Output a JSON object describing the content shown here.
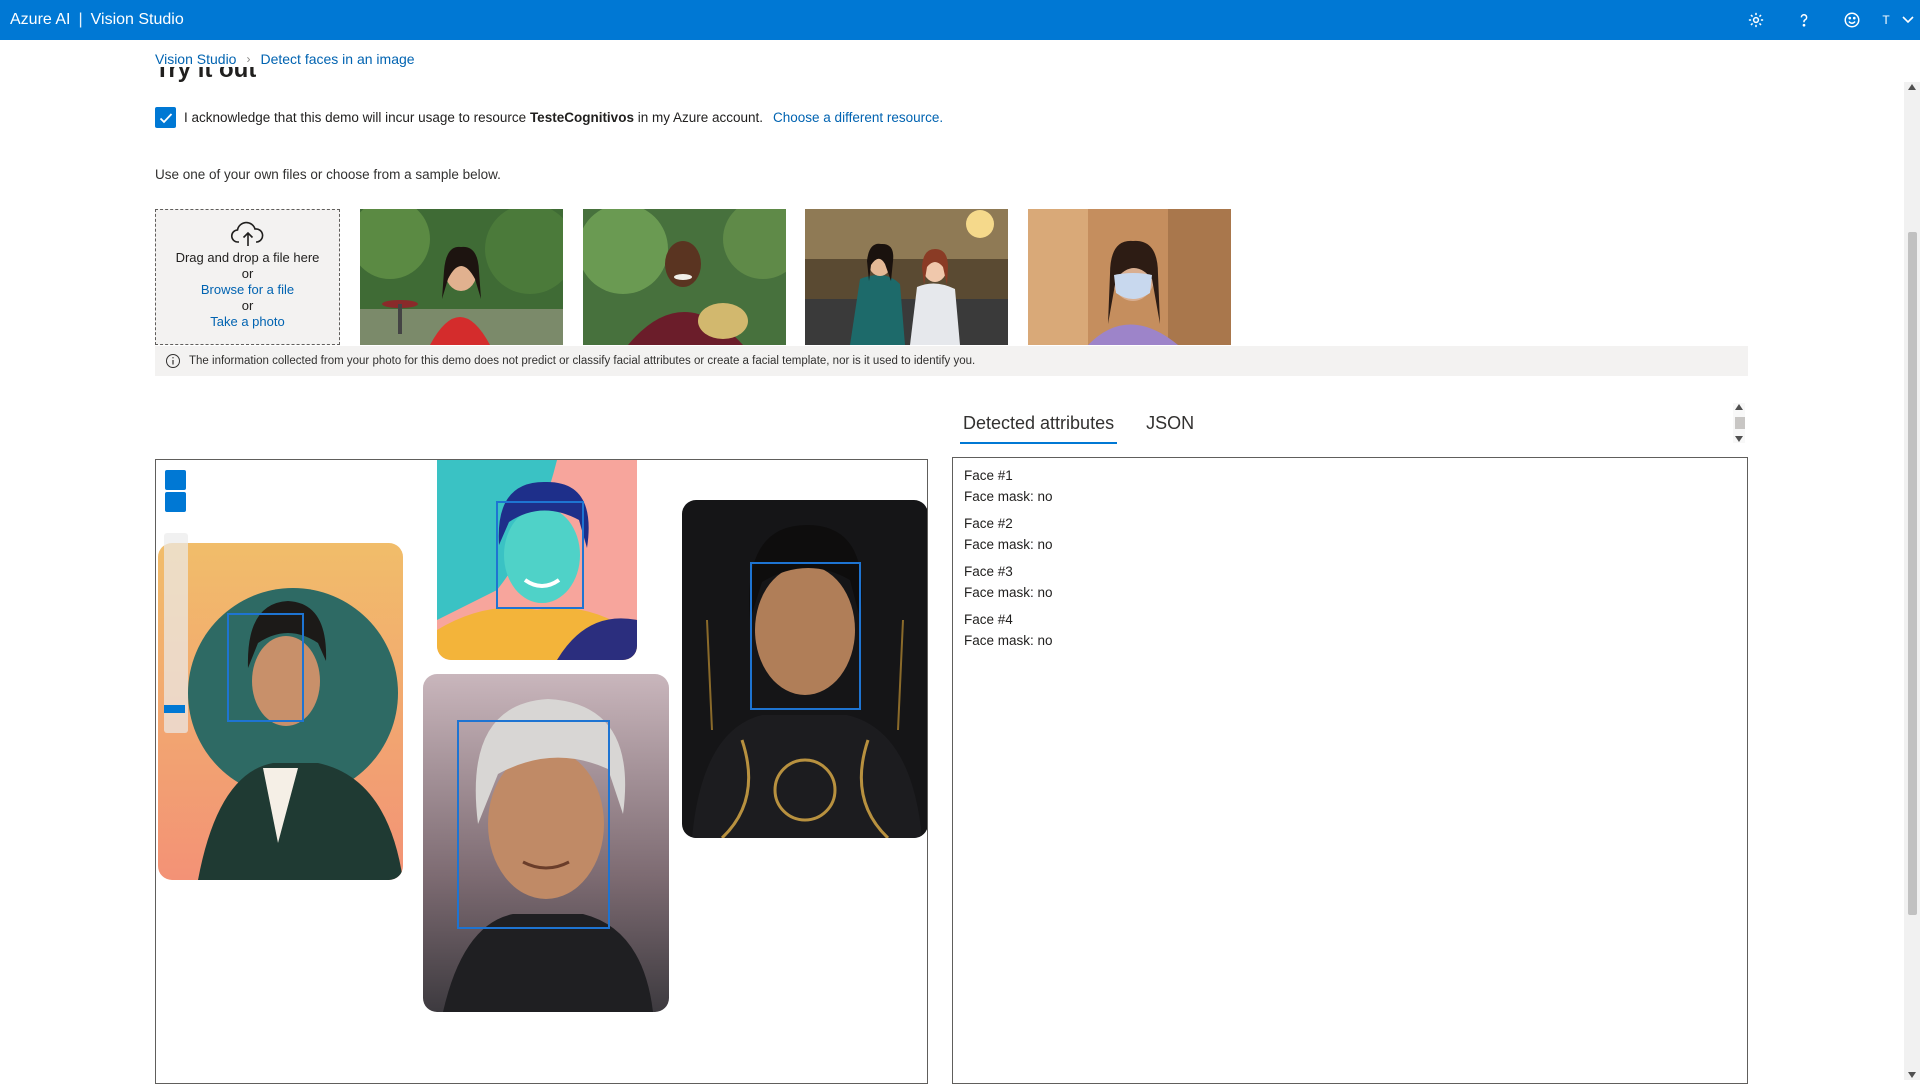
{
  "header": {
    "brand": "Azure AI",
    "separator": "|",
    "product": "Vision Studio",
    "user_initial": "T",
    "icons": [
      "settings-icon",
      "help-icon",
      "feedback-smiley-icon",
      "chevron-down-icon"
    ]
  },
  "breadcrumb": {
    "root": "Vision Studio",
    "current": "Detect faces in an image"
  },
  "section_title": "Try it out",
  "acknowledge": {
    "checked": true,
    "text_before": "I acknowledge that this demo will incur usage to resource ",
    "resource": "TesteCognitivos",
    "text_after": " in my Azure account.",
    "change_link": "Choose a different resource."
  },
  "intro_text": "Use one of your own files or choose from a sample below.",
  "upload": {
    "drag_text": "Drag and drop a file here",
    "or1": "or",
    "browse_link": "Browse for a file",
    "or2": "or",
    "photo_link": "Take a photo"
  },
  "info_text": "The information collected from your photo for this demo does not predict or classify facial attributes or create a facial template, nor is it used to identify you.",
  "tabs": [
    {
      "label": "Detected attributes",
      "active": true
    },
    {
      "label": "JSON",
      "active": false
    }
  ],
  "faces": [
    {
      "title": "Face #1",
      "mask": "Face mask: no"
    },
    {
      "title": "Face #2",
      "mask": "Face mask: no"
    },
    {
      "title": "Face #3",
      "mask": "Face mask: no"
    },
    {
      "title": "Face #4",
      "mask": "Face mask: no"
    }
  ],
  "colors": {
    "accent": "#0078d4",
    "link": "#0063b1",
    "face_box": "#1e74d2"
  }
}
